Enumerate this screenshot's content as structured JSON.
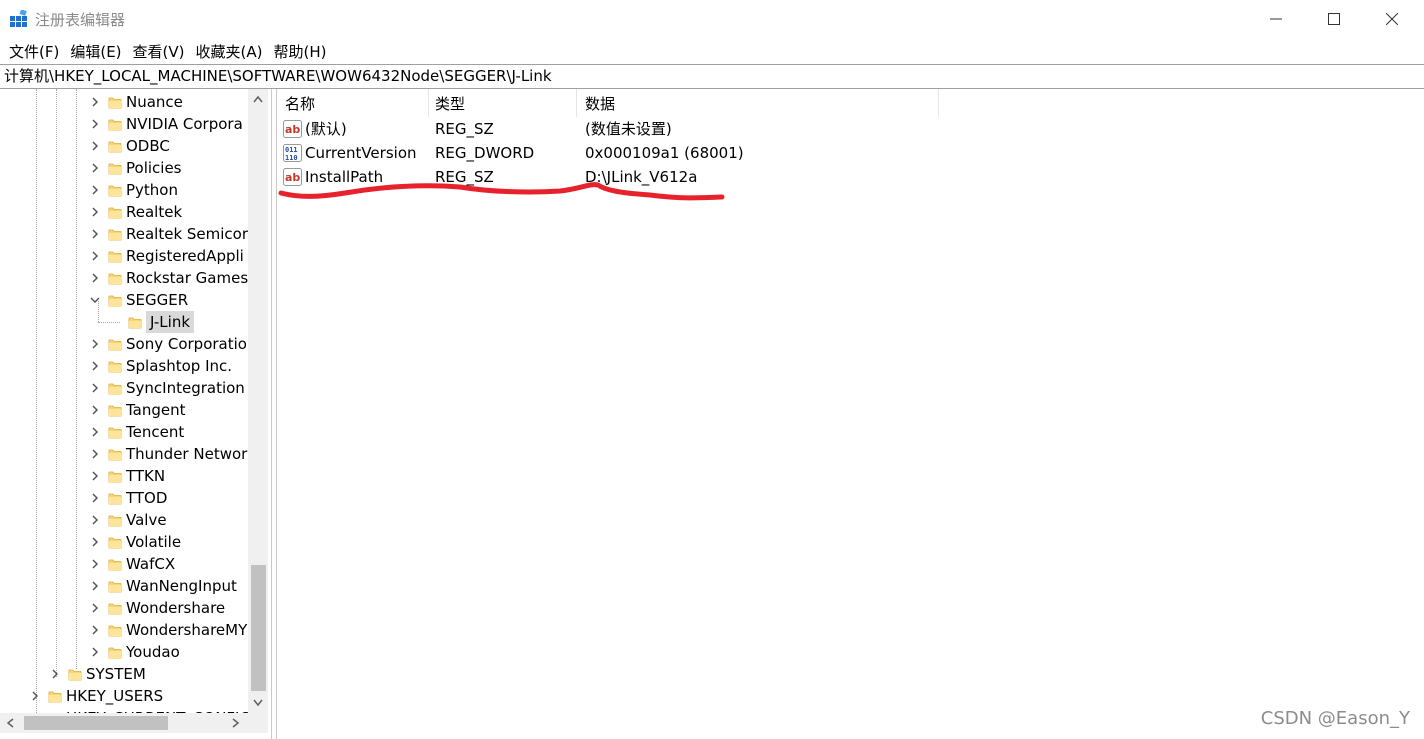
{
  "window": {
    "title": "注册表编辑器",
    "icon": "registry-editor-icon"
  },
  "menu": [
    {
      "label": "文件(F)"
    },
    {
      "label": "编辑(E)"
    },
    {
      "label": "查看(V)"
    },
    {
      "label": "收藏夹(A)"
    },
    {
      "label": "帮助(H)"
    }
  ],
  "address": "计算机\\HKEY_LOCAL_MACHINE\\SOFTWARE\\WOW6432Node\\SEGGER\\J-Link",
  "tree": {
    "items": [
      {
        "label": "Nuance",
        "expanded": false
      },
      {
        "label": "NVIDIA Corpora",
        "expanded": false
      },
      {
        "label": "ODBC",
        "expanded": false
      },
      {
        "label": "Policies",
        "expanded": false
      },
      {
        "label": "Python",
        "expanded": false
      },
      {
        "label": "Realtek",
        "expanded": false
      },
      {
        "label": "Realtek Semicor",
        "expanded": false
      },
      {
        "label": "RegisteredAppli",
        "expanded": false
      },
      {
        "label": "Rockstar Games",
        "expanded": false
      },
      {
        "label": "SEGGER",
        "expanded": true
      },
      {
        "label": "J-Link",
        "selected": true
      },
      {
        "label": "Sony Corporatio",
        "expanded": false
      },
      {
        "label": "Splashtop Inc.",
        "expanded": false
      },
      {
        "label": "SyncIntegration",
        "expanded": false
      },
      {
        "label": "Tangent",
        "expanded": false
      },
      {
        "label": "Tencent",
        "expanded": false
      },
      {
        "label": "Thunder Networ",
        "expanded": false
      },
      {
        "label": "TTKN",
        "expanded": false
      },
      {
        "label": "TTOD",
        "expanded": false
      },
      {
        "label": "Valve",
        "expanded": false
      },
      {
        "label": "Volatile",
        "expanded": false
      },
      {
        "label": "WafCX",
        "expanded": false
      },
      {
        "label": "WanNengInput",
        "expanded": false
      },
      {
        "label": "Wondershare",
        "expanded": false
      },
      {
        "label": "WondershareMY",
        "expanded": false
      },
      {
        "label": "Youdao",
        "expanded": false
      },
      {
        "label": "SYSTEM",
        "expanded": false
      },
      {
        "label": "HKEY_USERS",
        "expanded": false
      },
      {
        "label": "HKEY_CURRENT_CONFIG",
        "expanded": false
      }
    ]
  },
  "list": {
    "columns": [
      {
        "label": "名称"
      },
      {
        "label": "类型"
      },
      {
        "label": "数据"
      }
    ],
    "rows": [
      {
        "name": "(默认)",
        "type": "REG_SZ",
        "data": "(数值未设置)",
        "icon": "string-value-icon"
      },
      {
        "name": "CurrentVersion",
        "type": "REG_DWORD",
        "data": "0x000109a1 (68001)",
        "icon": "binary-value-icon"
      },
      {
        "name": "InstallPath",
        "type": "REG_SZ",
        "data": "D:\\JLink_V612a",
        "icon": "string-value-icon"
      }
    ]
  },
  "annotation": {
    "color": "#e8222b"
  },
  "watermark": "CSDN @Eason_Y"
}
